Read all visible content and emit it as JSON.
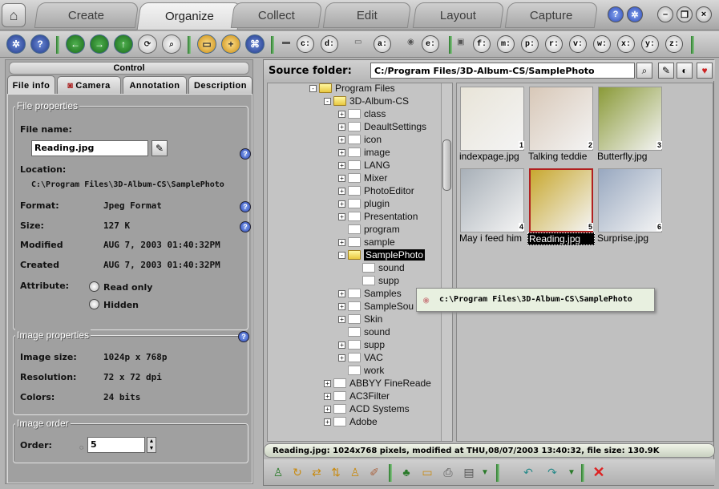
{
  "tabs": [
    "Create",
    "Organize",
    "Collect",
    "Edit",
    "Layout",
    "Capture"
  ],
  "active_tab": "Organize",
  "toolbar": {
    "drives": [
      "c:",
      "d:",
      "a:",
      "e:",
      "f:",
      "m:",
      "p:",
      "r:",
      "v:",
      "w:",
      "x:",
      "y:",
      "z:"
    ]
  },
  "left_panel": {
    "control_title": "Control",
    "tabs": [
      "File info",
      "Camera",
      "Annotation",
      "Description"
    ],
    "file_properties": {
      "title": "File properties",
      "file_name_label": "File name:",
      "file_name": "Reading.jpg",
      "location_label": "Location:",
      "location": "C:\\Program Files\\3D-Album-CS\\SamplePhoto",
      "format_label": "Format:",
      "format": "Jpeg Format",
      "size_label": "Size:",
      "size": "127 K",
      "modified_label": "Modified",
      "modified": "AUG 7, 2003  01:40:32PM",
      "created_label": "Created",
      "created": "AUG 7, 2003  01:40:32PM",
      "attribute_label": "Attribute:",
      "read_only": "Read only",
      "hidden": "Hidden"
    },
    "image_properties": {
      "title": "Image properties",
      "image_size_label": "Image size:",
      "image_size": "1024p x 768p",
      "resolution_label": "Resolution:",
      "resolution": "72 x 72 dpi",
      "colors_label": "Colors:",
      "colors": "24 bits"
    },
    "image_order": {
      "title": "Image order",
      "order_label": "Order:",
      "order": "5"
    }
  },
  "source": {
    "label": "Source folder:",
    "path": "C:/Program  Files/3D-Album-CS/SamplePhoto"
  },
  "tree": [
    {
      "label": "Program Files",
      "level": 0,
      "exp": "-",
      "open": true
    },
    {
      "label": "3D-Album-CS",
      "level": 1,
      "exp": "-",
      "open": true
    },
    {
      "label": "class",
      "level": 2,
      "exp": "+"
    },
    {
      "label": "DeaultSettings",
      "level": 2,
      "exp": "+"
    },
    {
      "label": "icon",
      "level": 2,
      "exp": "+"
    },
    {
      "label": "image",
      "level": 2,
      "exp": "+"
    },
    {
      "label": "LANG",
      "level": 2,
      "exp": "+"
    },
    {
      "label": "Mixer",
      "level": 2,
      "exp": "+"
    },
    {
      "label": "PhotoEditor",
      "level": 2,
      "exp": "+"
    },
    {
      "label": "plugin",
      "level": 2,
      "exp": "+"
    },
    {
      "label": "Presentation",
      "level": 2,
      "exp": "+"
    },
    {
      "label": "program",
      "level": 2,
      "exp": ""
    },
    {
      "label": "sample",
      "level": 2,
      "exp": "+"
    },
    {
      "label": "SamplePhoto",
      "level": 2,
      "exp": "-",
      "open": true,
      "selected": true
    },
    {
      "label": "sound",
      "level": 3,
      "exp": ""
    },
    {
      "label": "supp",
      "level": 3,
      "exp": ""
    },
    {
      "label": "Samples",
      "level": 2,
      "exp": "+"
    },
    {
      "label": "SampleSou",
      "level": 2,
      "exp": "+"
    },
    {
      "label": "Skin",
      "level": 2,
      "exp": "+"
    },
    {
      "label": "sound",
      "level": 2,
      "exp": ""
    },
    {
      "label": "supp",
      "level": 2,
      "exp": "+"
    },
    {
      "label": "VAC",
      "level": 2,
      "exp": "+"
    },
    {
      "label": "work",
      "level": 2,
      "exp": ""
    },
    {
      "label": "ABBYY FineReade",
      "level": 1,
      "exp": "+"
    },
    {
      "label": "AC3Filter",
      "level": 1,
      "exp": "+"
    },
    {
      "label": "ACD Systems",
      "level": 1,
      "exp": "+"
    },
    {
      "label": "Adobe",
      "level": 1,
      "exp": "+"
    }
  ],
  "tooltip": "c:\\Program Files\\3D-Album-CS\\SamplePhoto",
  "thumbnails": [
    {
      "name": "indexpage.jpg",
      "num": "1",
      "color": "#e8e4d8"
    },
    {
      "name": "Talking teddie",
      "num": "2",
      "color": "#d8c8b8"
    },
    {
      "name": "Butterfly.jpg",
      "num": "3",
      "color": "#8a9a38"
    },
    {
      "name": "May i feed him",
      "num": "4",
      "color": "#a8b0b8"
    },
    {
      "name": "Reading.jpg",
      "num": "5",
      "color": "#c8a830",
      "selected": true
    },
    {
      "name": "Surprise.jpg",
      "num": "6",
      "color": "#98a8c0"
    }
  ],
  "status": "Reading.jpg: 1024x768 pixels, modified at THU,08/07/2003 13:40:32, file size: 130.9K"
}
